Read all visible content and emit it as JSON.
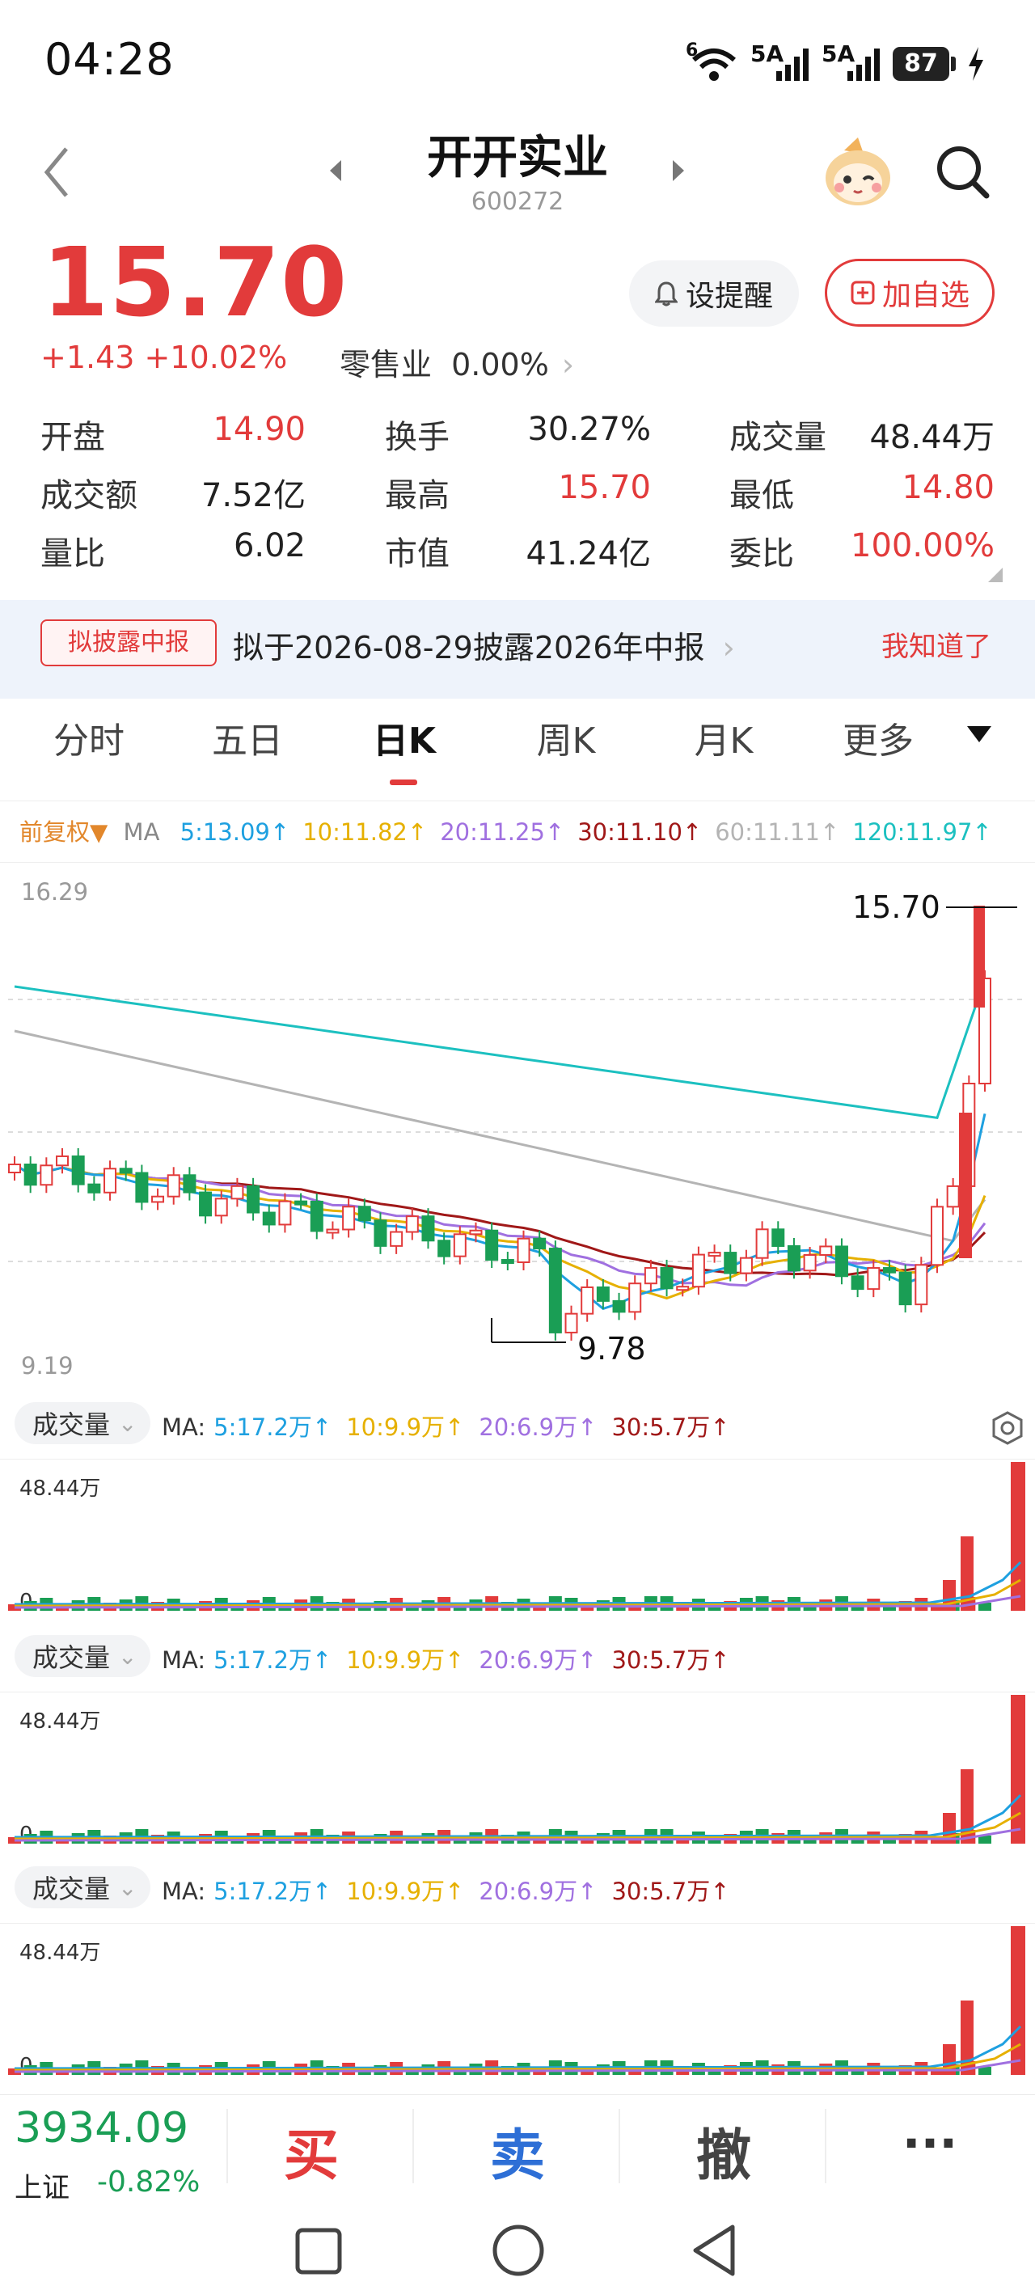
{
  "status": {
    "time": "04:28",
    "net1": "6",
    "net2": "5A",
    "net3": "5A",
    "battery": "87"
  },
  "header": {
    "name": "开开实业",
    "code": "600272"
  },
  "quote": {
    "price": "15.70",
    "change": "+1.43 +10.02%",
    "industry_name": "零售业",
    "industry_change": "0.00%",
    "remind_label": "设提醒",
    "fav_label": "加自选"
  },
  "stats": [
    {
      "label": "开盘",
      "value": "14.90",
      "color": "#e23b3b"
    },
    {
      "label": "换手",
      "value": "30.27%",
      "color": "#222222"
    },
    {
      "label": "成交量",
      "value": "48.44万",
      "color": "#222222"
    },
    {
      "label": "成交额",
      "value": "7.52亿",
      "color": "#222222"
    },
    {
      "label": "最高",
      "value": "15.70",
      "color": "#e23b3b"
    },
    {
      "label": "最低",
      "value": "14.80",
      "color": "#e23b3b"
    },
    {
      "label": "量比",
      "value": "6.02",
      "color": "#222222"
    },
    {
      "label": "市值",
      "value": "41.24亿",
      "color": "#222222"
    },
    {
      "label": "委比",
      "value": "100.00%",
      "color": "#e23b3b"
    }
  ],
  "notice": {
    "tag": "拟披露中报",
    "text": "拟于2026-08-29披露2026年中报",
    "ack": "我知道了"
  },
  "tabs": [
    "分时",
    "五日",
    "日K",
    "周K",
    "月K",
    "更多"
  ],
  "ma_bar": {
    "adjust": "前复权",
    "prefix": "MA",
    "items": [
      {
        "label": "5:13.09",
        "color": "#1ea0e0"
      },
      {
        "label": "10:11.82",
        "color": "#e6b000"
      },
      {
        "label": "20:11.25",
        "color": "#a070e0"
      },
      {
        "label": "30:11.10",
        "color": "#a01818"
      },
      {
        "label": "60:11.11",
        "color": "#b4b4b4"
      },
      {
        "label": "120:11.97",
        "color": "#1cc0c0"
      }
    ]
  },
  "kline": {
    "high_label": "16.29",
    "low_label": "9.19",
    "max_mark": "15.70",
    "min_mark": "9.78"
  },
  "volume_panels": [
    {
      "title": "成交量",
      "prefix": "MA:",
      "max": "48.44万",
      "zero": "0"
    },
    {
      "title": "成交量",
      "prefix": "MA:",
      "max": "48.44万",
      "zero": "0"
    },
    {
      "title": "成交量",
      "prefix": "MA:",
      "max": "48.44万",
      "zero": "0"
    }
  ],
  "vol_ma": [
    {
      "label": "5:17.2万",
      "color": "#1ea0e0"
    },
    {
      "label": "10:9.9万",
      "color": "#e6b000"
    },
    {
      "label": "20:6.9万",
      "color": "#a070e0"
    },
    {
      "label": "30:5.7万",
      "color": "#a01818"
    }
  ],
  "bottom": {
    "index_value": "3934.09",
    "index_name": "上证",
    "index_pct": "-0.82%",
    "buy": "买",
    "sell": "卖",
    "cancel": "撤",
    "more": "···"
  },
  "colors": {
    "up": "#e23b3b",
    "down": "#1a9e55"
  }
}
